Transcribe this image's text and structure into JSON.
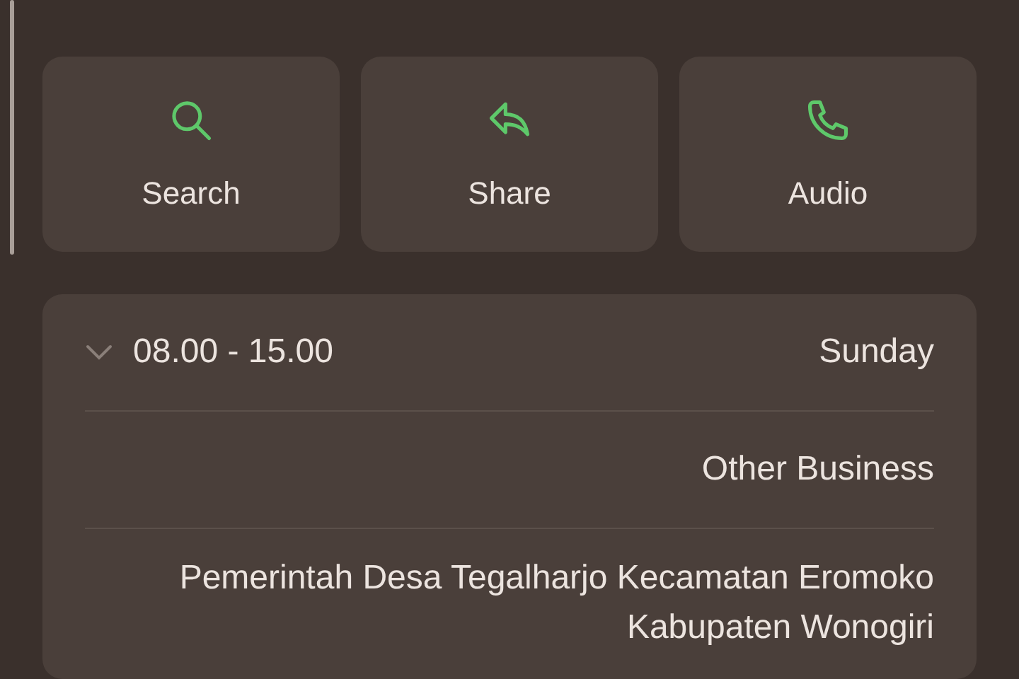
{
  "actions": [
    {
      "kind": "search",
      "label": "Search"
    },
    {
      "kind": "share",
      "label": "Share"
    },
    {
      "kind": "audio",
      "label": "Audio"
    }
  ],
  "hours": {
    "day": "Sunday",
    "time": "08.00 - 15.00",
    "expanded": false
  },
  "category": "Other Business",
  "address": "Pemerintah Desa Tegalharjo Kecamatan Eromoko Kabupaten Wonogiri"
}
